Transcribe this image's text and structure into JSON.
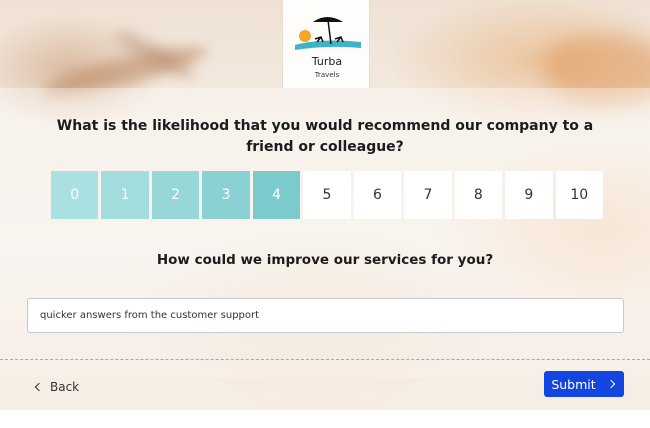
{
  "brand": {
    "name": "Turba",
    "subtitle": "Travels"
  },
  "survey": {
    "nps_question": "What is the likelihood that you would recommend our company to a friend or colleague?",
    "scale": [
      "0",
      "1",
      "2",
      "3",
      "4",
      "5",
      "6",
      "7",
      "8",
      "9",
      "10"
    ],
    "selected_value": 4,
    "selected_colors": [
      "#a9e0e1",
      "#a2dcdd",
      "#97d7d8",
      "#89d1d2",
      "#7ccbcc"
    ],
    "improve_question": "How could we improve our services for you?",
    "improve_answer": "quicker answers from the customer support"
  },
  "nav": {
    "back_label": "Back",
    "submit_label": "Submit"
  },
  "colors": {
    "accent": "#1346e0",
    "selected_teal": "#7ccbcc"
  }
}
